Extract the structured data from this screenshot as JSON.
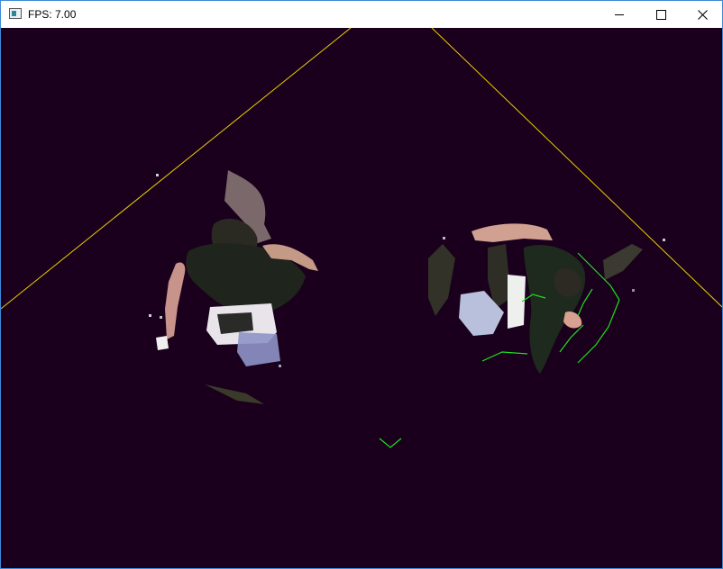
{
  "window": {
    "title": "FPS: 7.00",
    "controls": {
      "minimize": "minimize",
      "maximize": "maximize",
      "close": "close"
    }
  },
  "viewport": {
    "background_color": "#1a001c",
    "frustum_line_color": "#e8d000",
    "skeleton_color": "#1ee01e",
    "subjects": [
      {
        "name": "person-left",
        "skeleton_tracked": false
      },
      {
        "name": "person-right",
        "skeleton_tracked": true
      }
    ]
  }
}
